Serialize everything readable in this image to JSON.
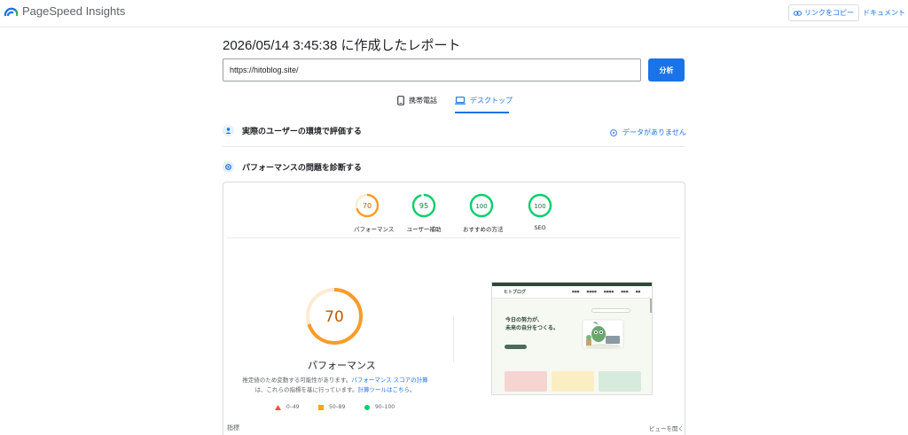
{
  "app": {
    "brand": "PageSpeed Insights"
  },
  "header": {
    "copy_link": "リンクをコピー",
    "docs": "ドキュメント"
  },
  "report": {
    "title": "2026/05/14 3:45:38 に作成したレポート"
  },
  "search": {
    "url": "https://hitoblog.site/",
    "analyze": "分析"
  },
  "tabs": [
    {
      "label": "携帯電話"
    },
    {
      "label": "デスクトップ"
    }
  ],
  "sections": {
    "field": {
      "title": "実際のユーザーの環境で評価する",
      "no_data": "データがありません"
    },
    "lab": {
      "title": "パフォーマンスの問題を診断する"
    }
  },
  "scores": [
    {
      "label": "パフォーマンス",
      "value": 70,
      "color": "#fa9b28",
      "track": "#fdebd3",
      "text": "#c05b00"
    },
    {
      "label": "ユーザー補助",
      "value": 95,
      "color": "#0cce6b",
      "track": "#d5f5e3",
      "text": "#0d7a3f"
    },
    {
      "label": "おすすめの方法",
      "value": 100,
      "color": "#0cce6b",
      "track": "#d5f5e3",
      "text": "#0d7a3f"
    },
    {
      "label": "SEO",
      "value": 100,
      "color": "#0cce6b",
      "track": "#d5f5e3",
      "text": "#0d7a3f"
    }
  ],
  "main_score": {
    "value": 70,
    "label": "パフォーマンス",
    "desc_prefix": "推定値のため変動する可能性があります。",
    "desc_link1": "パフォーマンス スコアの計算",
    "desc_mid": "は、これらの指標を基に行っています。",
    "desc_link2": "計算ツールはこちら。"
  },
  "legend": [
    {
      "range": "0–49",
      "color": "#ff4e42",
      "shape": "triangle"
    },
    {
      "range": "50–89",
      "color": "#ffa400",
      "shape": "square"
    },
    {
      "range": "90–100",
      "color": "#0cce6b",
      "shape": "circle"
    }
  ],
  "footer": {
    "metrics": "指標",
    "view": "ビューを開く"
  },
  "screenshot": {
    "site_name": "ヒトブログ",
    "hero_line1": "今日の努力が、",
    "hero_line2": "未来の自分をつくる。",
    "card_colors": [
      "#f6d4d2",
      "#fbeec2",
      "#d6ebdc"
    ]
  },
  "colors": {
    "accent": "#1a73e8"
  }
}
